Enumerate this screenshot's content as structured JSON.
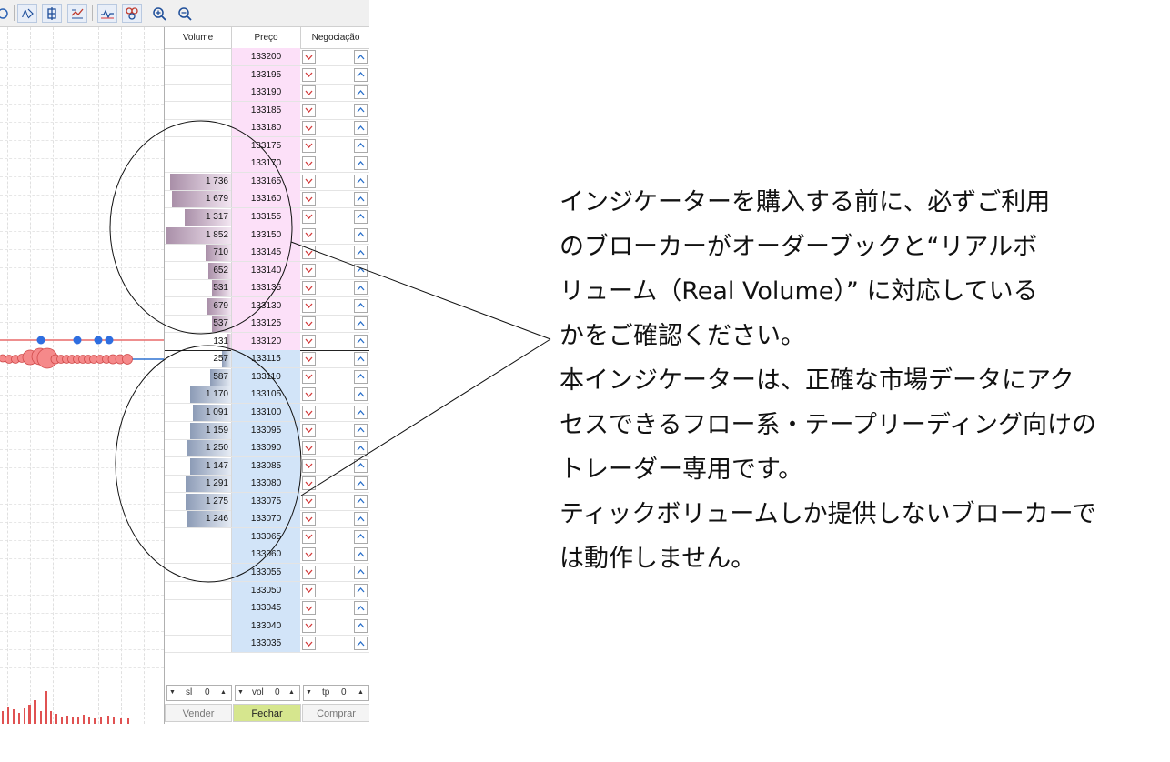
{
  "depth_of_market": {
    "headers": {
      "volume": "Volume",
      "price": "Preço",
      "trading": "Negociação"
    },
    "ask_color": "#fce0f8",
    "bid_color": "#d2e4f8",
    "ask_bar_color": "#a98fa8",
    "bid_bar_color": "#8c9bb6",
    "rows": [
      {
        "price": "133200",
        "volume": "",
        "volume_value": 0,
        "side": "ask"
      },
      {
        "price": "133195",
        "volume": "",
        "volume_value": 0,
        "side": "ask"
      },
      {
        "price": "133190",
        "volume": "",
        "volume_value": 0,
        "side": "ask"
      },
      {
        "price": "133185",
        "volume": "",
        "volume_value": 0,
        "side": "ask"
      },
      {
        "price": "133180",
        "volume": "",
        "volume_value": 0,
        "side": "ask"
      },
      {
        "price": "133175",
        "volume": "",
        "volume_value": 0,
        "side": "ask"
      },
      {
        "price": "133170",
        "volume": "",
        "volume_value": 0,
        "side": "ask"
      },
      {
        "price": "133165",
        "volume": "1 736",
        "volume_value": 1736,
        "side": "ask"
      },
      {
        "price": "133160",
        "volume": "1 679",
        "volume_value": 1679,
        "side": "ask"
      },
      {
        "price": "133155",
        "volume": "1 317",
        "volume_value": 1317,
        "side": "ask"
      },
      {
        "price": "133150",
        "volume": "1 852",
        "volume_value": 1852,
        "side": "ask"
      },
      {
        "price": "133145",
        "volume": "710",
        "volume_value": 710,
        "side": "ask"
      },
      {
        "price": "133140",
        "volume": "652",
        "volume_value": 652,
        "side": "ask"
      },
      {
        "price": "133135",
        "volume": "531",
        "volume_value": 531,
        "side": "ask"
      },
      {
        "price": "133130",
        "volume": "679",
        "volume_value": 679,
        "side": "ask"
      },
      {
        "price": "133125",
        "volume": "537",
        "volume_value": 537,
        "side": "ask"
      },
      {
        "price": "133120",
        "volume": "131",
        "volume_value": 131,
        "side": "ask"
      },
      {
        "price": "133115",
        "volume": "257",
        "volume_value": 257,
        "side": "bid"
      },
      {
        "price": "133110",
        "volume": "587",
        "volume_value": 587,
        "side": "bid"
      },
      {
        "price": "133105",
        "volume": "1 170",
        "volume_value": 1170,
        "side": "bid"
      },
      {
        "price": "133100",
        "volume": "1 091",
        "volume_value": 1091,
        "side": "bid"
      },
      {
        "price": "133095",
        "volume": "1 159",
        "volume_value": 1159,
        "side": "bid"
      },
      {
        "price": "133090",
        "volume": "1 250",
        "volume_value": 1250,
        "side": "bid"
      },
      {
        "price": "133085",
        "volume": "1 147",
        "volume_value": 1147,
        "side": "bid"
      },
      {
        "price": "133080",
        "volume": "1 291",
        "volume_value": 1291,
        "side": "bid"
      },
      {
        "price": "133075",
        "volume": "1 275",
        "volume_value": 1275,
        "side": "bid"
      },
      {
        "price": "133070",
        "volume": "1 246",
        "volume_value": 1246,
        "side": "bid"
      },
      {
        "price": "133065",
        "volume": "",
        "volume_value": 0,
        "side": "bid"
      },
      {
        "price": "133060",
        "volume": "",
        "volume_value": 0,
        "side": "bid"
      },
      {
        "price": "133055",
        "volume": "",
        "volume_value": 0,
        "side": "bid"
      },
      {
        "price": "133050",
        "volume": "",
        "volume_value": 0,
        "side": "bid"
      },
      {
        "price": "133045",
        "volume": "",
        "volume_value": 0,
        "side": "bid"
      },
      {
        "price": "133040",
        "volume": "",
        "volume_value": 0,
        "side": "bid"
      },
      {
        "price": "133035",
        "volume": "",
        "volume_value": 0,
        "side": "bid"
      }
    ],
    "controls": {
      "sl_label": "sl",
      "sl_value": "0",
      "vol_label": "vol",
      "vol_value": "0",
      "tp_label": "tp",
      "tp_value": "0"
    },
    "actions": {
      "sell": "Vender",
      "close": "Fechar",
      "buy": "Comprar"
    }
  },
  "toolbar_icons": [
    "partial-icon",
    "text-format-icon",
    "bar-chart-icon",
    "line-chart-icon",
    "indicator-icon",
    "objects-icon",
    "zoom-in-icon",
    "zoom-out-icon"
  ],
  "annotation": {
    "lines": [
      "インジケーターを購入する前に、必ずご利用",
      "のブローカーがオーダーブックと“リアルボ",
      "リューム（Real Volume）” に対応している",
      "かをご確認ください。",
      "本インジケーターは、正確な市場データにアク",
      "セスできるフロー系・テープリーディング向けの",
      "トレーダー専用です。",
      "ティックボリュームしか提供しないブローカーで",
      "は動作しません。"
    ]
  }
}
